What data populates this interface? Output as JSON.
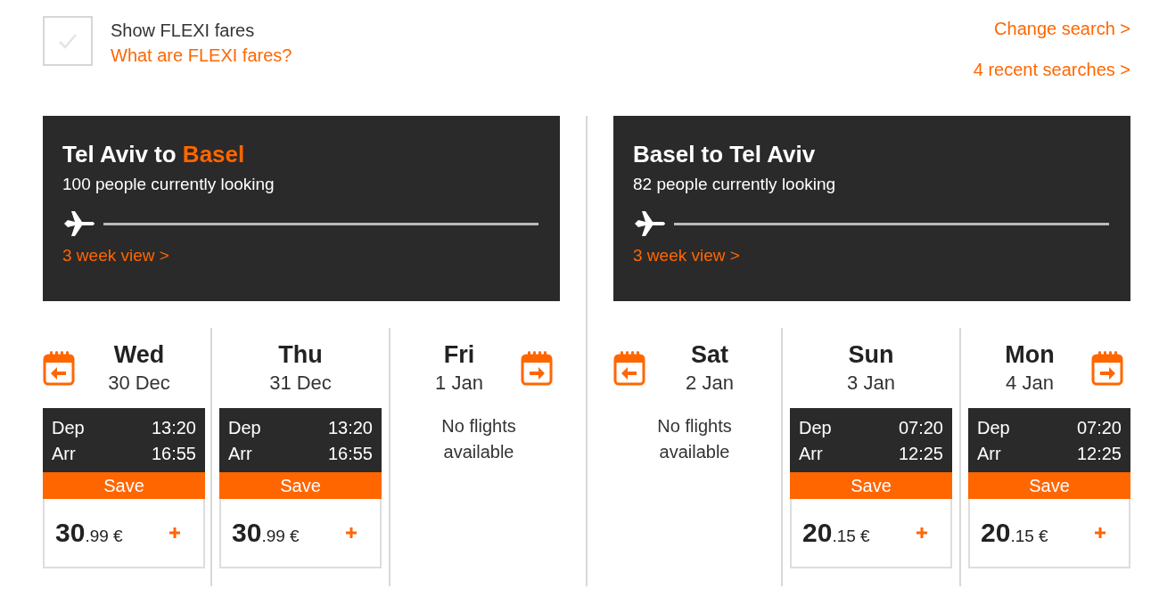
{
  "flexi": {
    "label": "Show FLEXI fares",
    "checked": false,
    "link": "What are FLEXI fares?"
  },
  "links": [
    "Change search >",
    "4 recent searches >"
  ],
  "legs": [
    {
      "title": {
        "text": "Tel Aviv to",
        "destination": "Basel"
      },
      "looking": "100 people currently looking",
      "week_link": "3 week view >",
      "days": [
        {
          "day": "Wed",
          "date": "30 Dec",
          "prev_button": true,
          "next_button": false,
          "flight": {
            "dep_label": "Dep",
            "dep": "13:20",
            "arr_label": "Arr",
            "arr": "16:55",
            "badge": "Save",
            "price_main": "30",
            "price_fraction": ".99 €"
          }
        },
        {
          "day": "Thu",
          "date": "31 Dec",
          "prev_button": false,
          "next_button": false,
          "flight": {
            "dep_label": "Dep",
            "dep": "13:20",
            "arr_label": "Arr",
            "arr": "16:55",
            "badge": "Save",
            "price_main": "30",
            "price_fraction": ".99 €"
          }
        },
        {
          "day": "Fri",
          "date": "1 Jan",
          "prev_button": false,
          "next_button": true,
          "message": "No flights available"
        }
      ]
    },
    {
      "title": {
        "text": "Basel to Tel Aviv"
      },
      "looking": "82 people currently looking",
      "week_link": "3 week view >",
      "days": [
        {
          "day": "Sat",
          "date": "2 Jan",
          "prev_button": true,
          "next_button": false,
          "message": "No flights available"
        },
        {
          "day": "Sun",
          "date": "3 Jan",
          "prev_button": false,
          "next_button": false,
          "flight": {
            "dep_label": "Dep",
            "dep": "07:20",
            "arr_label": "Arr",
            "arr": "12:25",
            "badge": "Save",
            "price_main": "20",
            "price_fraction": ".15 €"
          }
        },
        {
          "day": "Mon",
          "date": "4 Jan",
          "prev_button": false,
          "next_button": true,
          "flight": {
            "dep_label": "Dep",
            "dep": "07:20",
            "arr_label": "Arr",
            "arr": "12:25",
            "badge": "Save",
            "price_main": "20",
            "price_fraction": ".15 €"
          }
        }
      ]
    }
  ]
}
